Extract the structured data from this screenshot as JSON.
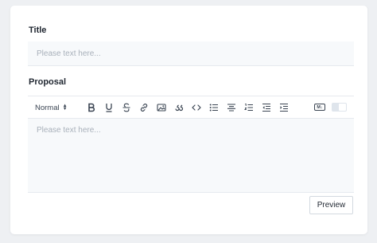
{
  "form": {
    "title_label": "Title",
    "title_placeholder": "Please text here...",
    "title_value": "",
    "proposal_label": "Proposal",
    "editor_placeholder": "Please text here...",
    "editor_value": "",
    "preview_label": "Preview"
  },
  "toolbar": {
    "heading_value": "Normal",
    "markdown_badge": "M↓",
    "markdown_toggle_on": false,
    "icons": [
      "bold-icon",
      "underline-icon",
      "strikethrough-icon",
      "link-icon",
      "image-icon",
      "blockquote-icon",
      "code-icon",
      "bullet-list-icon",
      "align-center-icon",
      "ordered-list-icon",
      "outdent-icon",
      "indent-icon"
    ]
  },
  "colors": {
    "background": "#eef0f3",
    "card": "#ffffff",
    "input_bg": "#f7f9fb",
    "text": "#1f2630",
    "placeholder": "#a8b0ba"
  }
}
